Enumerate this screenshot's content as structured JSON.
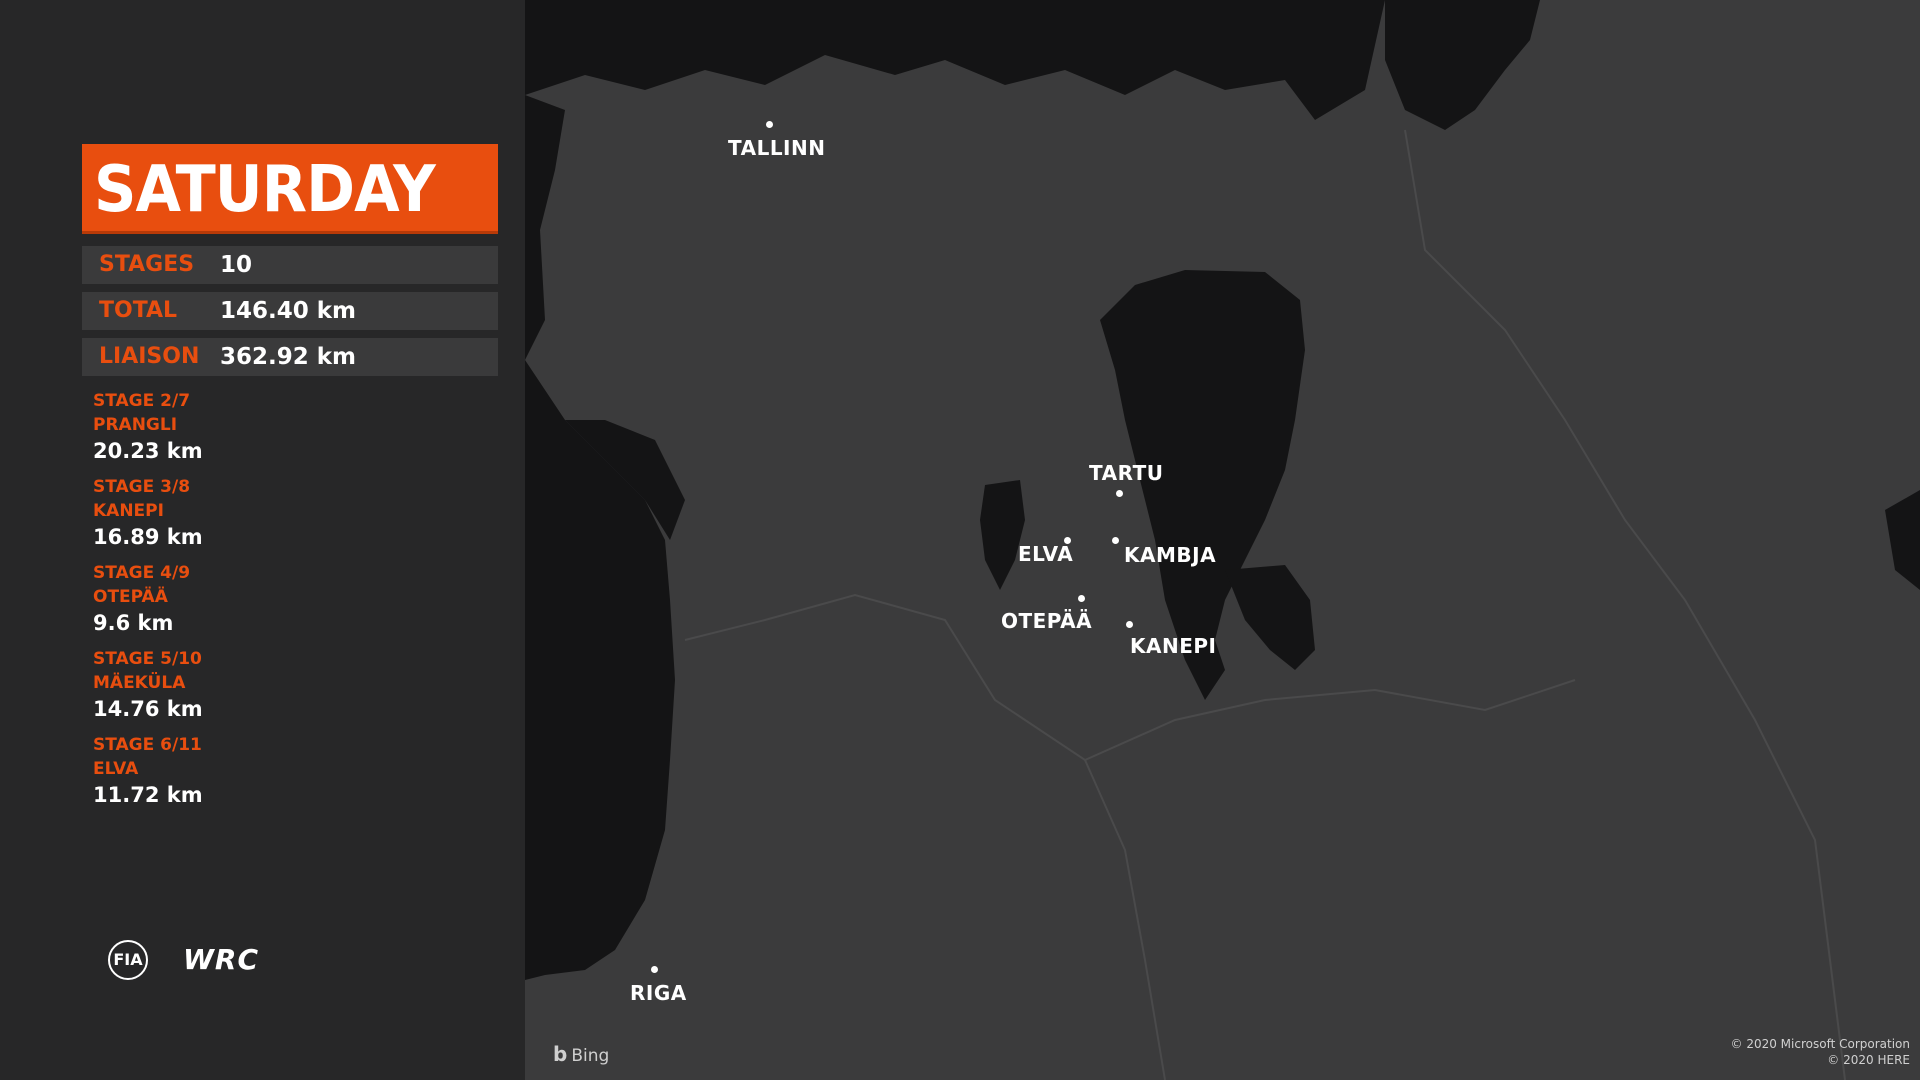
{
  "sidebar": {
    "day": "SATURDAY",
    "stats": [
      {
        "label": "STAGES",
        "value": "10"
      },
      {
        "label": "TOTAL",
        "value": "146.40 km"
      },
      {
        "label": "LIAISON",
        "value": "362.92 km"
      }
    ],
    "stages": [
      {
        "title": "STAGE 2/7",
        "name": "PRANGLI",
        "distance": "20.23 km"
      },
      {
        "title": "STAGE 3/8",
        "name": "KANEPI",
        "distance": "16.89 km"
      },
      {
        "title": "STAGE 4/9",
        "name": "OTEPÄÄ",
        "distance": "9.6 km"
      },
      {
        "title": "STAGE 5/10",
        "name": "MÄEKÜLA",
        "distance": "14.76 km"
      },
      {
        "title": "STAGE 6/11",
        "name": "ELVA",
        "distance": "11.72 km"
      }
    ],
    "logos": {
      "fia": "FIA",
      "wrc": "WRC"
    }
  },
  "map": {
    "cities": [
      "TALLINN",
      "TARTU",
      "ELVA",
      "KAMBJA",
      "OTEPÄÄ",
      "KANEPI",
      "RIGA"
    ],
    "attribution": "Bing",
    "copyright": [
      "© 2020 Microsoft Corporation",
      "© 2020 HERE"
    ]
  },
  "colors": {
    "accent": "#e84e0f",
    "panel": "#272728",
    "land": "#3b3b3c",
    "water": "#141415"
  }
}
